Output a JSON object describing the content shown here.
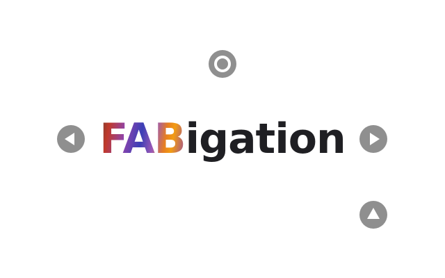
{
  "title": {
    "highlight": "FAB",
    "rest": "igation"
  },
  "icons": {
    "home": "circle-outline-icon",
    "back": "triangle-left-icon",
    "forward": "triangle-right-icon",
    "top": "triangle-up-icon"
  },
  "colors": {
    "fab": "#8f8f8f",
    "text": "#1f1f23",
    "background": "#ffffff"
  }
}
